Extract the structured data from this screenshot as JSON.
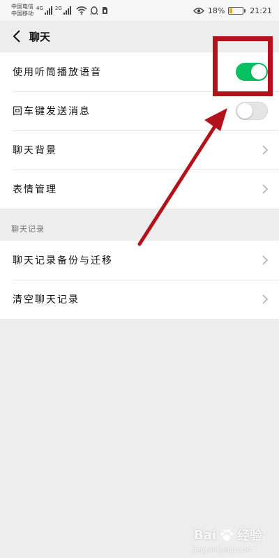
{
  "status_bar": {
    "carrier_1": "中国电信",
    "carrier_2": "中国移动",
    "network_1": "4G",
    "network_2": "2G",
    "battery_text": "18%",
    "battery_level": 0.18,
    "time": "21:21",
    "icons": [
      "signal-icon",
      "wifi-icon",
      "qq-icon",
      "sim-icon",
      "eye-icon",
      "battery-icon"
    ]
  },
  "header": {
    "title": "聊天",
    "back_icon": "chevron-left-icon"
  },
  "group1": [
    {
      "label": "使用听筒播放语音",
      "toggle": true
    },
    {
      "label": "回车键发送消息",
      "toggle": false
    },
    {
      "label": "聊天背景",
      "chevron": true
    },
    {
      "label": "表情管理",
      "chevron": true
    }
  ],
  "section2": {
    "label": "聊天记录"
  },
  "group2": [
    {
      "label": "聊天记录备份与迁移",
      "chevron": true
    },
    {
      "label": "清空聊天记录",
      "chevron": true
    }
  ],
  "colors": {
    "toggle_on": "#07c160",
    "toggle_off": "#e5e5e5",
    "annotation": "#b3121c",
    "background": "#ededed"
  },
  "watermark": {
    "brand": "Bai",
    "brand_cn": "经验",
    "sub": "jingyan.baidu.com"
  }
}
